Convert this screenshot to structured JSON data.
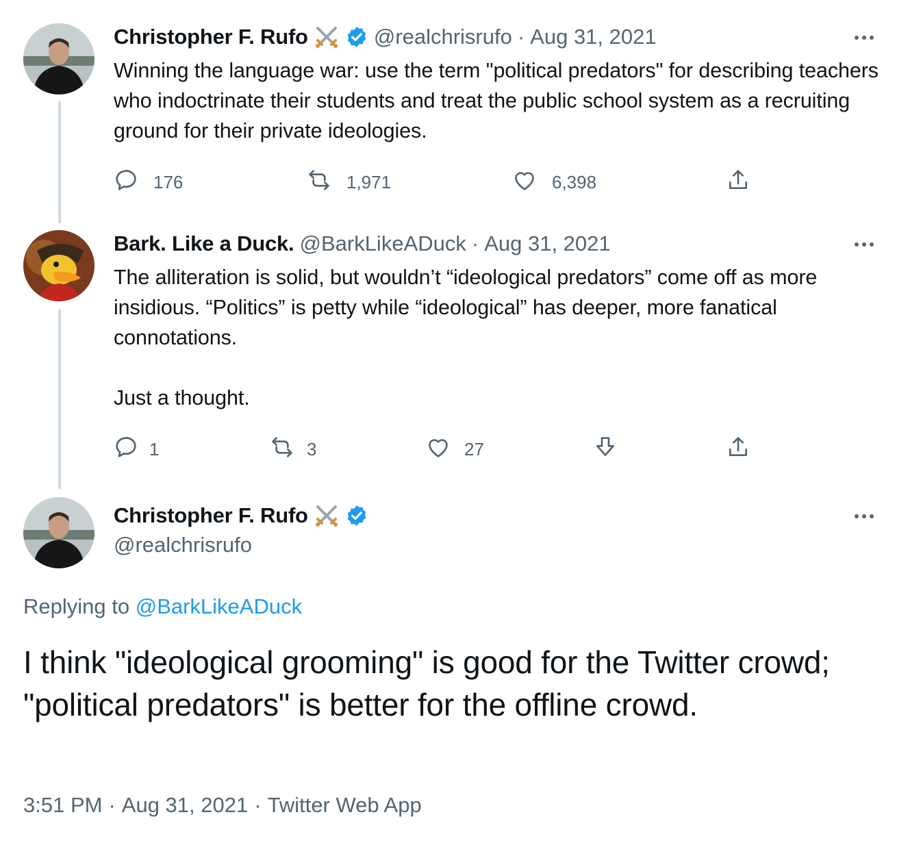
{
  "tweets": [
    {
      "name": "Christopher F. Rufo",
      "handle": "@realchrisrufo",
      "date": "Aug 31, 2021",
      "text": "Winning the language war: use the term \"political predators\" for describing teachers who indoctrinate their students and treat the public school system as a recruiting ground for their private ideologies.",
      "replies": "176",
      "retweets": "1,971",
      "likes": "6,398"
    },
    {
      "name": "Bark. Like a Duck.",
      "handle": "@BarkLikeADuck",
      "date": "Aug 31, 2021",
      "text": "The alliteration is solid, but wouldn’t “ideological predators” come off as more insidious. “Politics” is petty while “ideological” has deeper, more fanatical connotations.\n\nJust a thought.",
      "replies": "1",
      "retweets": "3",
      "likes": "27"
    }
  ],
  "main": {
    "name": "Christopher F. Rufo",
    "handle": "@realchrisrufo",
    "replying_prefix": "Replying to",
    "replying_handle": "@BarkLikeADuck",
    "text": "I think \"ideological grooming\" is good for the Twitter crowd; \"political predators\" is better for the offline crowd.",
    "time": "3:51 PM",
    "date": "Aug 31, 2021",
    "source": "Twitter Web App",
    "separator": "·"
  },
  "colors": {
    "text": "#0f1419",
    "secondary": "#536471",
    "link": "#1d9bf0",
    "verified": "#1d9bf0",
    "thread_line": "#cfd9de"
  },
  "icons": [
    "crossed-swords-icon",
    "verified-badge-icon",
    "more-icon",
    "reply-icon",
    "retweet-icon",
    "like-icon",
    "downvote-icon",
    "share-icon"
  ]
}
